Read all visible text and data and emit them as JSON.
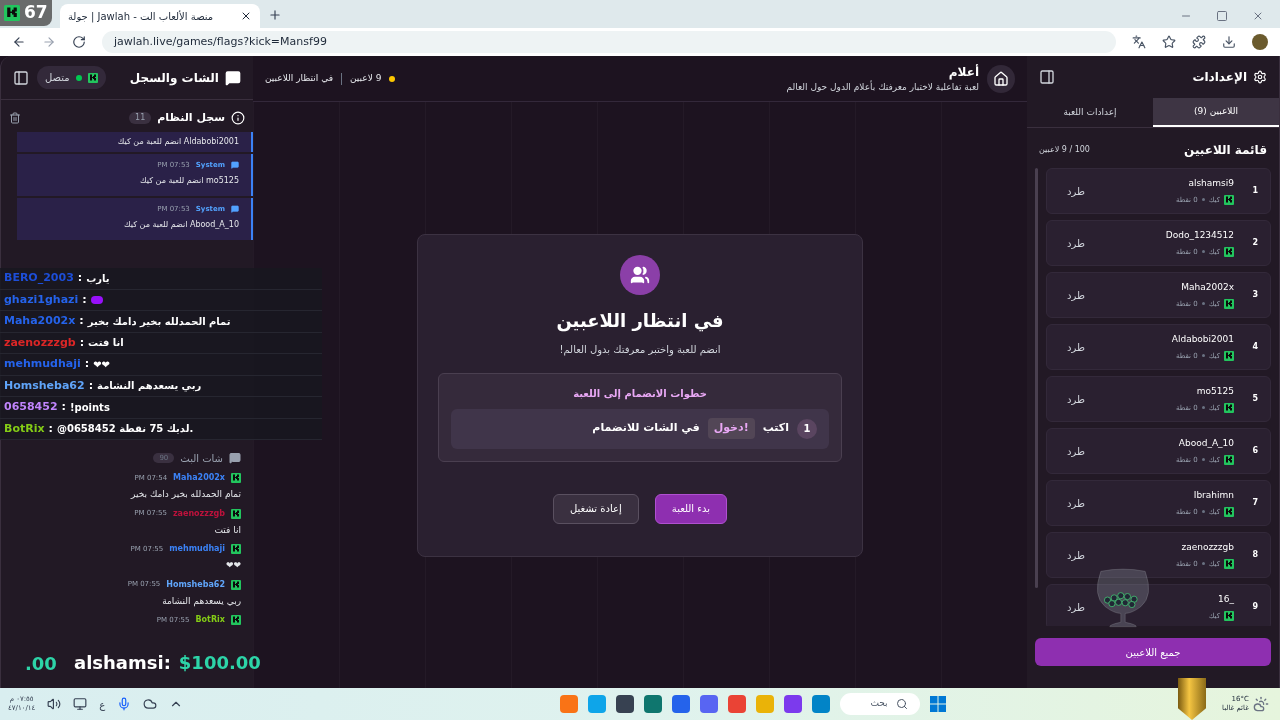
{
  "browser": {
    "tab_title": "جولة | Jawlah - منصة الألعاب الت",
    "url": "jawlah.live/games/flags?kick=Mansf99"
  },
  "stream_counter": "67",
  "left_panel": {
    "title": "الشات والسجل",
    "status": "متصل",
    "log_title": "سجل النظام",
    "log_count": "11",
    "log": [
      {
        "kind": "text",
        "text": "Aldabobi2001 انضم للعبة من كيك"
      },
      {
        "kind": "full",
        "sender": "System",
        "time": "PM 07:53",
        "text": "mo5125 انضم للعبة من كيك"
      },
      {
        "kind": "full",
        "sender": "System",
        "time": "PM 07:53",
        "text": "Abood_A_10 انضم للعبة من كيك"
      }
    ],
    "chat_title": "شات البث",
    "chat_count": "90",
    "chat": [
      {
        "user": "Maha2002x",
        "color": "#3b82f6",
        "time": "PM 07:54",
        "text": "تمام الحمدلله بخير دامك بخير"
      },
      {
        "user": "zaenozzzgb",
        "color": "#be123c",
        "time": "PM 07:55",
        "text": "انا فتت"
      },
      {
        "user": "mehmudhaji",
        "color": "#3b82f6",
        "time": "PM 07:55",
        "text": "❤❤"
      },
      {
        "user": "Homsheba62",
        "color": "#60a5fa",
        "time": "PM 07:55",
        "text": "ربي يسعدهم النشامة"
      },
      {
        "user": "BotRix",
        "color": "#84cc16",
        "time": "PM 07:55"
      }
    ]
  },
  "stream_overlay": {
    "chat": [
      {
        "kind": "text",
        "user": "BERO_2003",
        "color": "#1d4ed8",
        "text": "يارب"
      },
      {
        "kind": "emote",
        "user": "ghazi1ghazi",
        "color": "#2563eb"
      },
      {
        "kind": "text",
        "user": "Maha2002x",
        "color": "#2563eb",
        "text": "تمام الحمدلله بخير دامك بخير"
      },
      {
        "kind": "text",
        "user": "zaenozzzgb",
        "color": "#dc2626",
        "text": "انا فتت"
      },
      {
        "kind": "text",
        "user": "mehmudhaji",
        "color": "#2563eb",
        "text": "❤❤"
      },
      {
        "kind": "text",
        "user": "Homsheba62",
        "color": "#60a5fa",
        "text": "ربي يسعدهم النشامة"
      },
      {
        "kind": "text",
        "user": "0658452",
        "color": "#c084fc",
        "text": "!points"
      },
      {
        "kind": "text",
        "user": "BotRix",
        "color": "#84cc16",
        "text": "@0658452 لديك 75 نقطة."
      }
    ],
    "separator": ":",
    "alert_fragment": ".00",
    "alert_name": "alshamsi:",
    "alert_amount": "$100.00"
  },
  "header": {
    "title": "أعلام",
    "subtitle": "لعبة تفاعلية لاختبار معرفتك بأعلام الدول حول العالم",
    "players": "9 لاعبين",
    "status": "في انتظار اللاعبين"
  },
  "modal": {
    "title": "في انتظار اللاعبين",
    "subtitle": "انضم للعبة واختبر معرفتك بدول العالم!",
    "steps_title": "خطوات الانضمام إلى اللعبة",
    "steps": [
      {
        "number": "1",
        "before": "اكتب",
        "command": "!دخول",
        "after": "في الشات للانضمام"
      }
    ],
    "buttons": [
      {
        "label": "بدء اللعبة",
        "kind": "primary"
      },
      {
        "label": "إعادة تشغيل",
        "kind": "secondary"
      }
    ]
  },
  "settings": {
    "title": "الإعدادات",
    "tabs": [
      {
        "label": "اللاعبين (9)",
        "selected": true
      },
      {
        "label": "إعدادات اللعبة",
        "selected": false
      }
    ],
    "list_title": "قائمة اللاعبين",
    "capacity": "100 / 9 لاعبين",
    "players": [
      {
        "rank": "1",
        "name": "alshamsi9",
        "platform": "كيك",
        "points": "0 نقطة",
        "action": "طرد"
      },
      {
        "rank": "2",
        "name": "Dodo_1234512",
        "platform": "كيك",
        "points": "0 نقطة",
        "action": "طرد"
      },
      {
        "rank": "3",
        "name": "Maha2002x",
        "platform": "كيك",
        "points": "0 نقطة",
        "action": "طرد"
      },
      {
        "rank": "4",
        "name": "Aldabobi2001",
        "platform": "كيك",
        "points": "0 نقطة",
        "action": "طرد"
      },
      {
        "rank": "5",
        "name": "mo5125",
        "platform": "كيك",
        "points": "0 نقطة",
        "action": "طرد"
      },
      {
        "rank": "6",
        "name": "Abood_A_10",
        "platform": "كيك",
        "points": "0 نقطة",
        "action": "طرد"
      },
      {
        "rank": "7",
        "name": "Ibrahimn",
        "platform": "كيك",
        "points": "0 نقطة",
        "action": "طرد"
      },
      {
        "rank": "8",
        "name": "zaenozzzgb",
        "platform": "كيك",
        "points": "0 نقطة",
        "action": "طرد"
      },
      {
        "rank": "9",
        "name": "_16",
        "platform": "كيك",
        "action": "طرد"
      }
    ],
    "bulk_action": "جميع اللاعبين"
  },
  "taskbar": {
    "search": "بحث",
    "language": "ع",
    "time": "٠٧:٥٥ م",
    "date": "٤٧/١٠/١٤",
    "temperature": "16°C",
    "weather": "غائم غالبا"
  }
}
